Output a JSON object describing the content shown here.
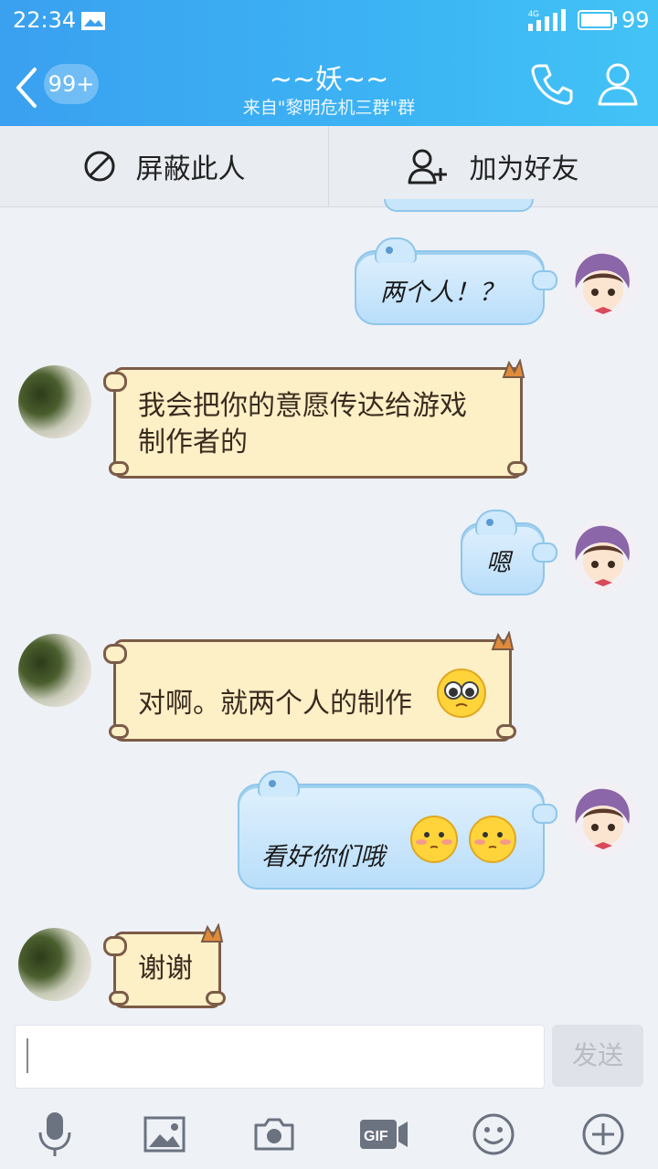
{
  "status_bar": {
    "time": "22:34",
    "network": "4G",
    "battery": "99"
  },
  "header": {
    "unread_badge": "99+",
    "title": "~~妖~~",
    "subtitle": "来自\"黎明危机三群\"群"
  },
  "actions": {
    "block_label": "屏蔽此人",
    "add_friend_label": "加为好友"
  },
  "messages": [
    {
      "side": "right",
      "text": "两个人！？"
    },
    {
      "side": "left",
      "line1": "我会把你的意愿传达给游戏",
      "line2": "制作者的"
    },
    {
      "side": "right",
      "text": "嗯"
    },
    {
      "side": "left",
      "text": "对啊。就两个人的制作",
      "emoji": "pleading-face"
    },
    {
      "side": "right",
      "text": "看好你们哦",
      "emoji": [
        "blush-face",
        "blush-face"
      ]
    },
    {
      "side": "left",
      "text": "谢谢"
    }
  ],
  "input": {
    "placeholder": "",
    "send_label": "发送"
  },
  "toolbar": [
    "microphone-icon",
    "image-icon",
    "camera-icon",
    "gif-icon",
    "emoji-icon",
    "plus-icon"
  ],
  "colors": {
    "header_accent": "#3aa0f0",
    "bubble_blue": "#c8e6fb",
    "bubble_cream": "#fdf0c6",
    "bubble_border": "#7b5c48"
  }
}
